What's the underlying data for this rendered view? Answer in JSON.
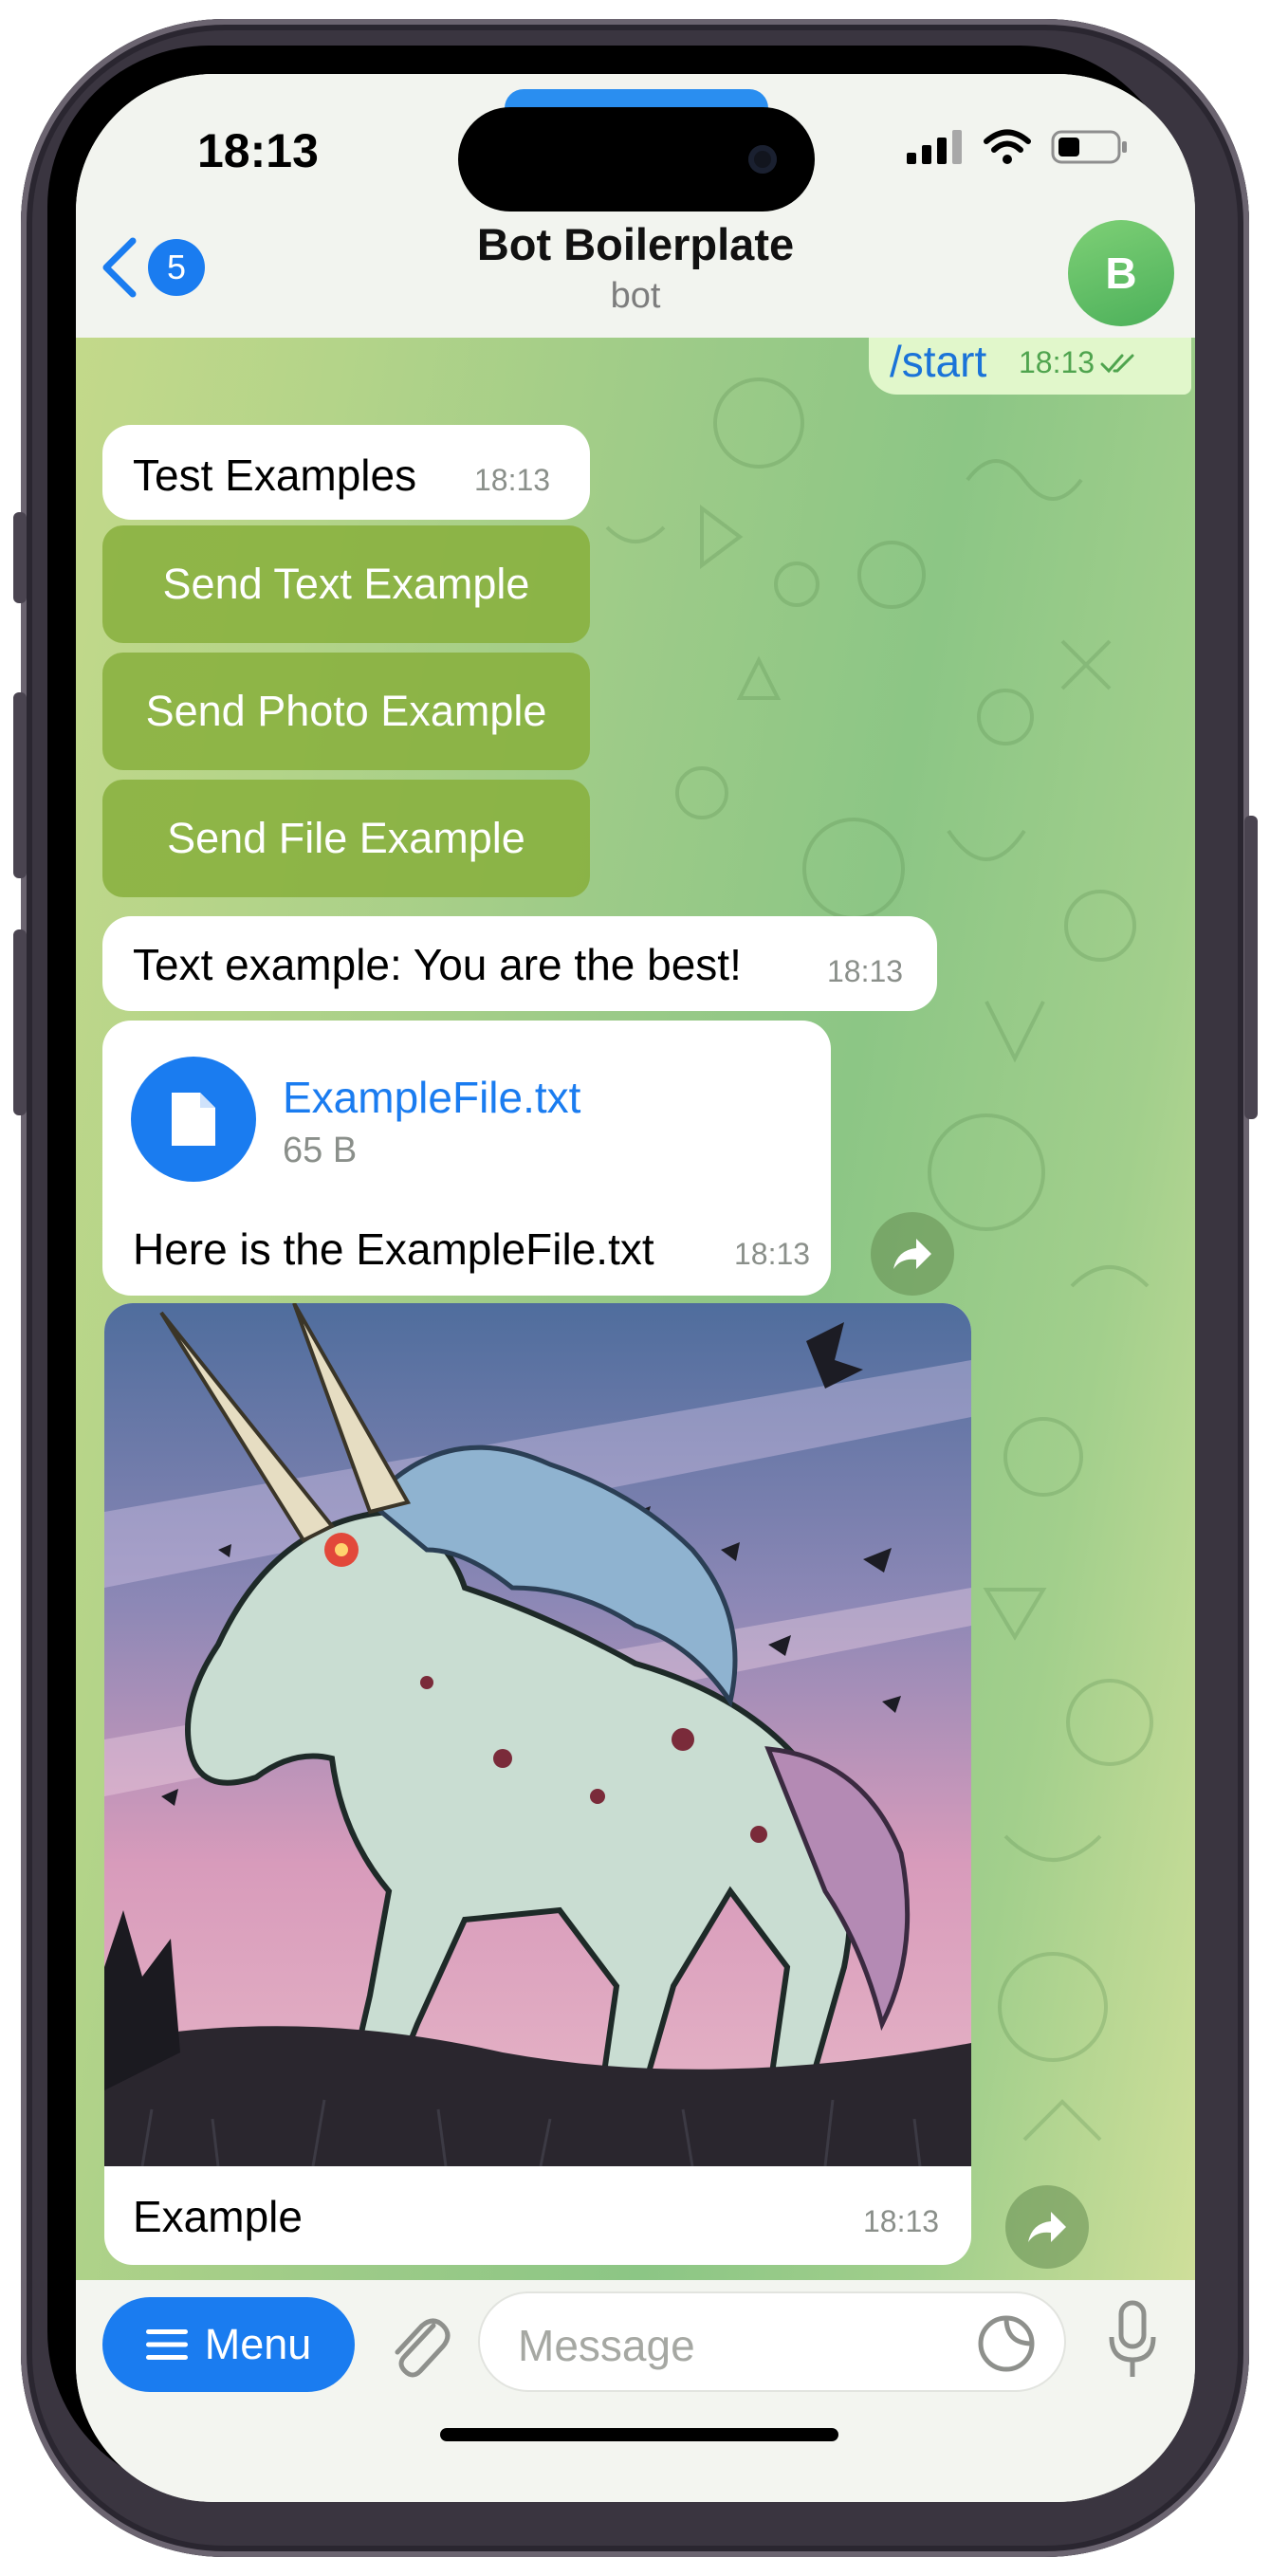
{
  "status_bar": {
    "time": "18:13"
  },
  "header": {
    "back_badge": "5",
    "title": "Bot Boilerplate",
    "subtitle": "bot",
    "avatar_letter": "B"
  },
  "messages": {
    "outgoing": {
      "text": "/start",
      "time": "18:13",
      "status_icon": "double-check-icon"
    },
    "test_examples": {
      "text": "Test Examples",
      "time": "18:13"
    },
    "keyboard": [
      "Send Text Example",
      "Send Photo Example",
      "Send File Example"
    ],
    "text_example": {
      "text": "Text example: You are the best!",
      "time": "18:13"
    },
    "file_message": {
      "file_name": "ExampleFile.txt",
      "file_size": "65 B",
      "caption": "Here is the ExampleFile.txt",
      "time": "18:13",
      "file_icon": "document-icon"
    },
    "photo_message": {
      "image_subject": "unicorn-illustration",
      "caption": "Example",
      "time": "18:13"
    }
  },
  "input_bar": {
    "menu_label": "Menu",
    "placeholder": "Message"
  },
  "colors": {
    "accent": "#1a7cf0",
    "outgoing_bubble": "#e1f7cb",
    "keyboard_button": "#87af3c",
    "avatar": "#5bbd62"
  }
}
